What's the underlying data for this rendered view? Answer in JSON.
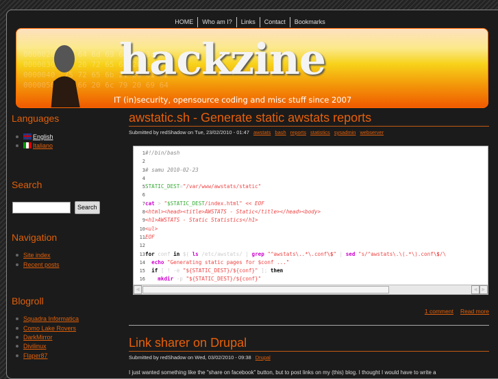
{
  "nav": [
    "HOME",
    "Who am I?",
    "Links",
    "Contact",
    "Bookmarks"
  ],
  "banner": {
    "logo": "hackzine",
    "tagline": "IT (in)security, opensource coding and misc stuff since 2007",
    "hex": "0000020  61 64 6d 69 6e 20 3d 20\n0000030  2d 20 72 65 64 20 6e 65\n0000040  75 72 65 6b 21 20 61 62\n0000050  74 66 20 6c 79 20 69 64"
  },
  "sidebar": {
    "languages": {
      "title": "Languages",
      "items": [
        "English",
        "Italiano"
      ]
    },
    "search": {
      "title": "Search",
      "button": "Search",
      "value": ""
    },
    "navigation": {
      "title": "Navigation",
      "items": [
        "Site index",
        "Recent posts"
      ]
    },
    "blogroll": {
      "title": "Blogroll",
      "items": [
        "Squadra Informatica",
        "Como Lake Rovers",
        "DarkMirror",
        "Divilinux",
        "Flaper87"
      ]
    }
  },
  "posts": [
    {
      "title": "awstatic.sh - Generate static awstats reports",
      "meta": "Submitted by redShadow on Tue, 23/02/2010 - 01:47",
      "tags": [
        "awstats",
        "bash",
        "reports",
        "statistics",
        "sysadmin",
        "webserver"
      ],
      "comments": "1 comment",
      "read_more": "Read more"
    },
    {
      "title": "Link sharer on Drupal",
      "meta": "Submitted by redShadow on Wed, 03/02/2010 - 09:38",
      "tags": [
        "Drupal"
      ],
      "body": "I just wanted something like the \"share on facebook\" button, but to post links on my (this) blog. I thought I would have to write a"
    }
  ],
  "colors": {
    "accent": "#e8600a",
    "background": "#1b1b1b"
  }
}
